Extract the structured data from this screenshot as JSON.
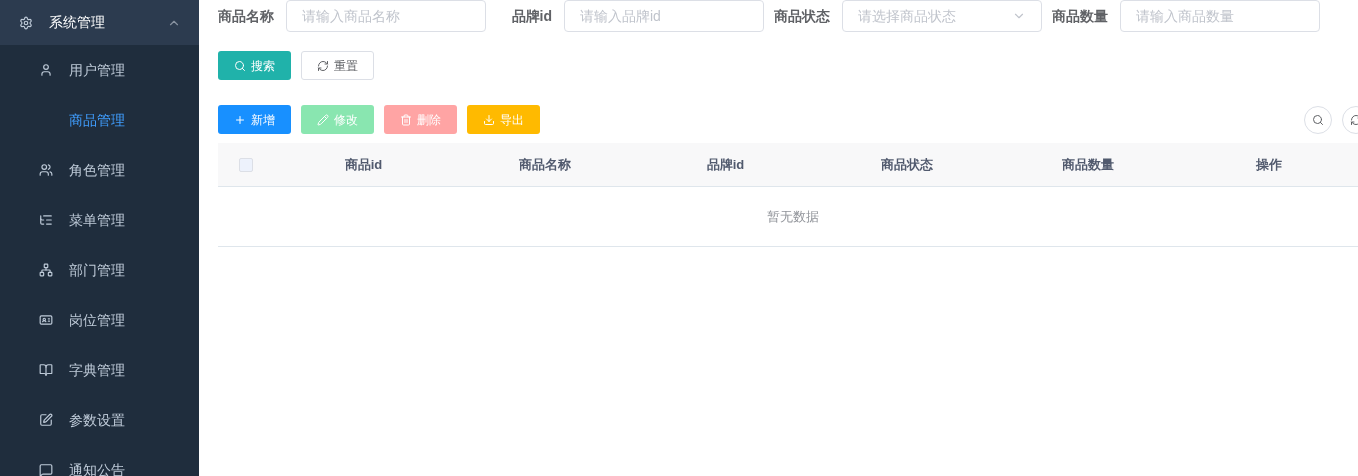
{
  "sidebar": {
    "group": {
      "label": "系统管理",
      "expanded": true
    },
    "items": [
      {
        "label": "用户管理",
        "selected": false
      },
      {
        "label": "商品管理",
        "selected": true
      },
      {
        "label": "角色管理",
        "selected": false
      },
      {
        "label": "菜单管理",
        "selected": false
      },
      {
        "label": "部门管理",
        "selected": false
      },
      {
        "label": "岗位管理",
        "selected": false
      },
      {
        "label": "字典管理",
        "selected": false
      },
      {
        "label": "参数设置",
        "selected": false
      },
      {
        "label": "通知公告",
        "selected": false
      }
    ]
  },
  "filters": [
    {
      "kind": "input",
      "label": "商品名称",
      "placeholder": "请输入商品名称"
    },
    {
      "kind": "input",
      "label": "品牌id",
      "placeholder": "请输入品牌id"
    },
    {
      "kind": "select",
      "label": "商品状态",
      "placeholder": "请选择商品状态"
    },
    {
      "kind": "input",
      "label": "商品数量",
      "placeholder": "请输入商品数量"
    }
  ],
  "search_buttons": [
    {
      "kind": "search",
      "label": "搜索"
    },
    {
      "kind": "reset",
      "label": "重置"
    }
  ],
  "actions": [
    {
      "kind": "add",
      "label": "新增",
      "disabled": false
    },
    {
      "kind": "edit",
      "label": "修改",
      "disabled": true
    },
    {
      "kind": "delete",
      "label": "删除",
      "disabled": true
    },
    {
      "kind": "export",
      "label": "导出",
      "disabled": false
    }
  ],
  "table": {
    "select_all": {
      "checked": false
    },
    "columns": [
      "商品id",
      "商品名称",
      "品牌id",
      "商品状态",
      "商品数量",
      "操作"
    ],
    "empty_text": "暂无数据"
  }
}
